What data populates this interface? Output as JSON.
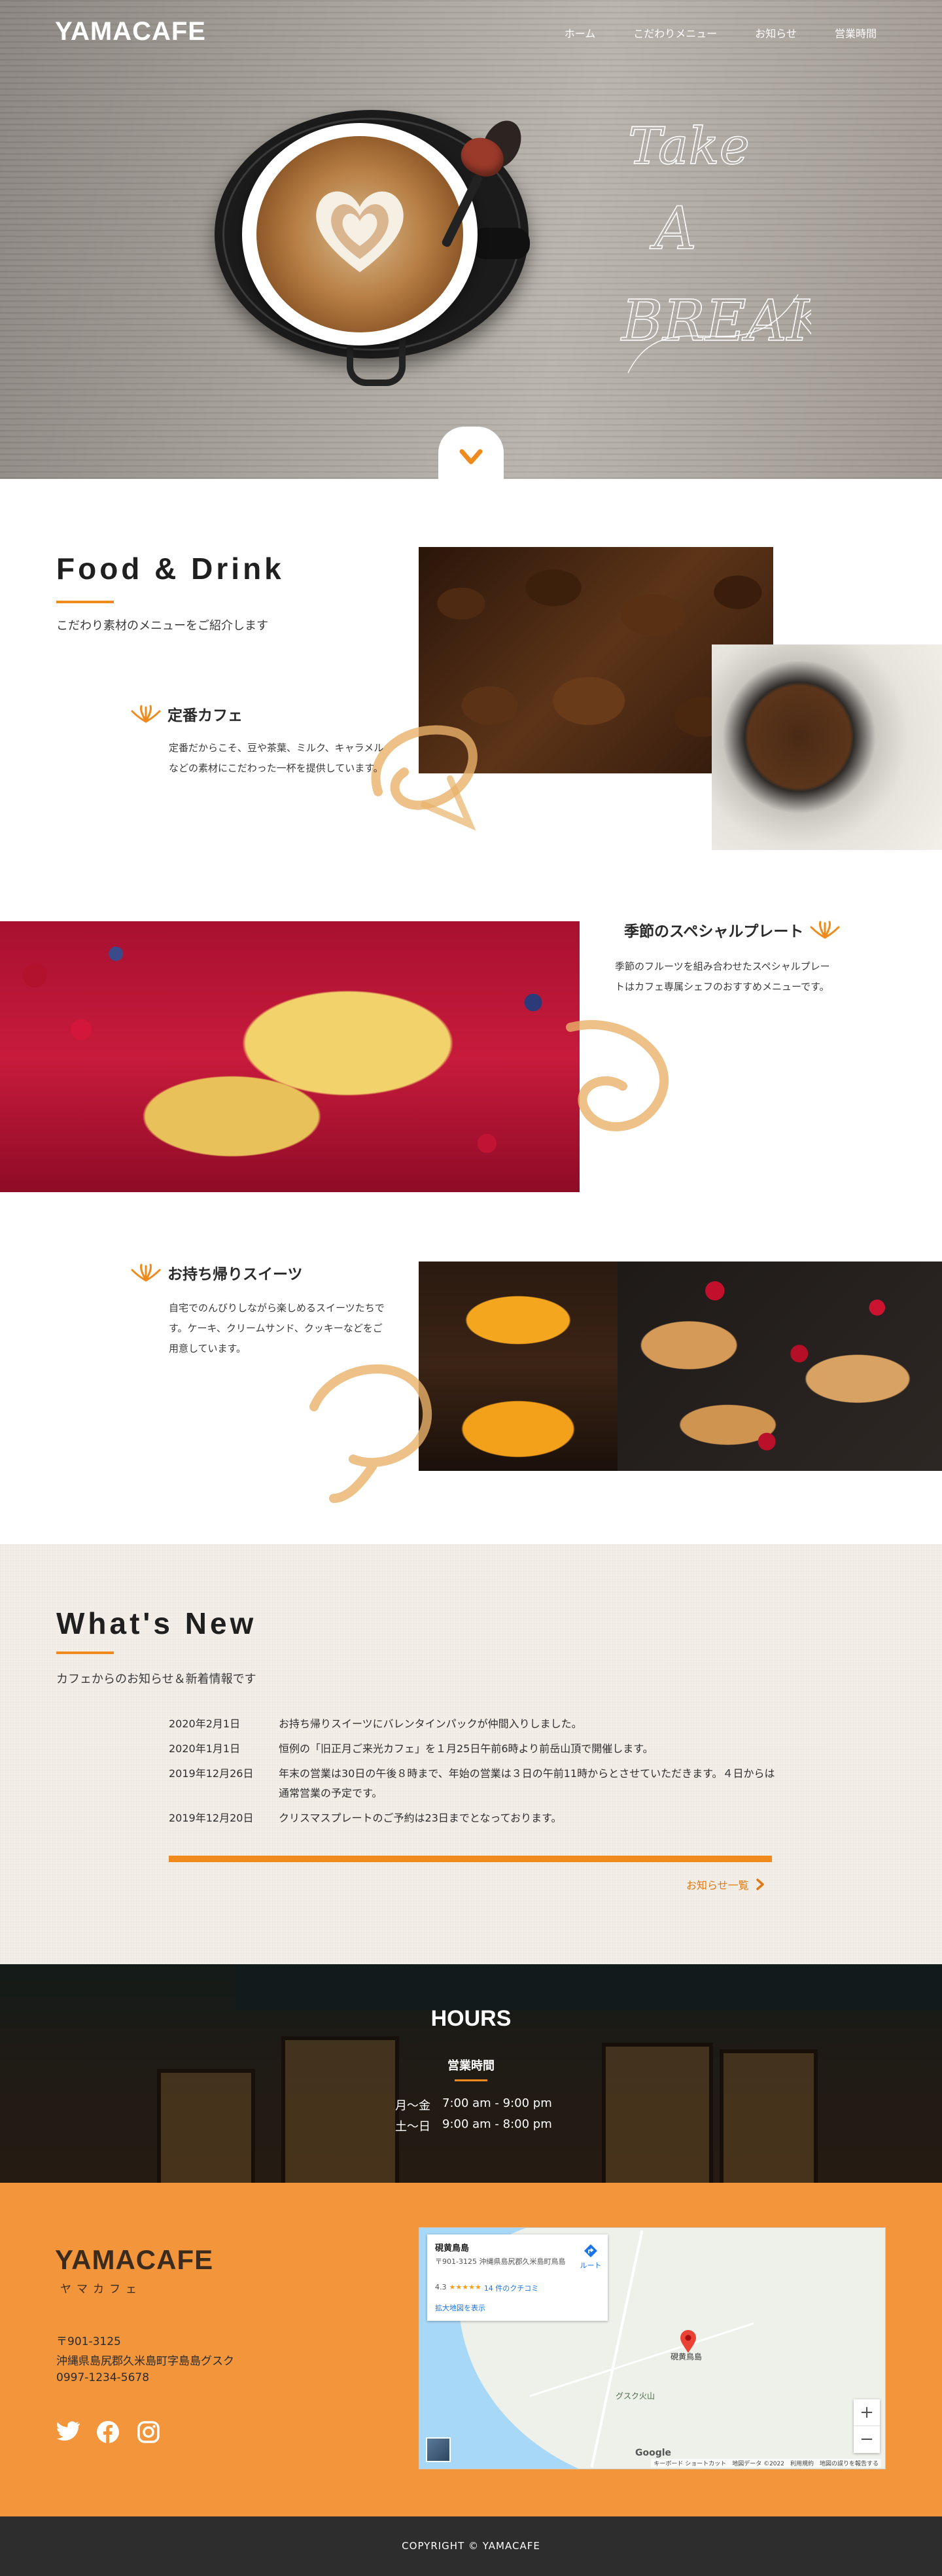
{
  "header": {
    "logo": "YAMACAFE",
    "nav": [
      "ホーム",
      "こだわりメニュー",
      "お知らせ",
      "営業時間"
    ]
  },
  "hero": {
    "script_text": "Take A BREAK"
  },
  "food_drink": {
    "title": "Food & Drink",
    "subtitle": "こだわり素材のメニューをご紹介します",
    "items": [
      {
        "title": "定番カフェ",
        "desc": "定番だからこそ、豆や茶葉、ミルク、キャラメルなどの素材にこだわった一杯を提供しています。"
      },
      {
        "title": "季節のスペシャルプレート",
        "desc": "季節のフルーツを組み合わせたスペシャルプレートはカフェ専属シェフのおすすめメニューです。"
      },
      {
        "title": "お持ち帰りスイーツ",
        "desc": "自宅でのんびりしながら楽しめるスイーツたちです。ケーキ、クリームサンド、クッキーなどをご用意しています。"
      }
    ]
  },
  "news": {
    "title": "What's New",
    "subtitle": "カフェからのお知らせ＆新着情報です",
    "entries": [
      {
        "date": "2020年2月1日",
        "text": "お持ち帰りスイーツにバレンタインパックが仲間入りしました。"
      },
      {
        "date": "2020年1月1日",
        "text": "恒例の「旧正月ご来光カフェ」を１月25日午前6時より前岳山頂で開催します。"
      },
      {
        "date": "2019年12月26日",
        "text": "年末の営業は30日の午後８時まで、年始の営業は３日の午前11時からとさせていただきます。４日からは通常営業の予定です。"
      },
      {
        "date": "2019年12月20日",
        "text": "クリスマスプレートのご予約は23日までとなっております。"
      }
    ],
    "more_label": "お知らせ一覧"
  },
  "hours": {
    "title": "HOURS",
    "subtitle": "営業時間",
    "rows": [
      {
        "days": "月〜金",
        "time": "7:00 am - 9:00 pm"
      },
      {
        "days": "土〜日",
        "time": "9:00 am - 8:00 pm"
      }
    ]
  },
  "footer": {
    "logo": "YAMACAFE",
    "logo_sub": "ヤマカフェ",
    "postal": "〒901-3125",
    "address": "沖縄県島尻郡久米島町字島島グスク",
    "phone": "0997-1234-5678",
    "social_icons": [
      "twitter-icon",
      "facebook-icon",
      "instagram-icon"
    ],
    "copyright": "COPYRIGHT © YAMACAFE"
  },
  "map": {
    "place_name": "硯黄鳥島",
    "place_address": "〒901-3125 沖縄県島尻郡久米島町鳥島",
    "rating": "4.3",
    "stars": "★★★★★",
    "reviews": "14 件のクチコミ",
    "enlarge_label": "拡大地図を表示",
    "route_label": "ルート",
    "pin_label": "硯黄鳥島",
    "peak_label": "グスク火山",
    "zoom_in": "+",
    "zoom_out": "−",
    "google_label": "Google",
    "attribution": "キーボード ショートカット　地図データ ©2022　利用規約　地図の誤りを報告する"
  },
  "colors": {
    "accent": "#f08a1c",
    "footer_bg": "#f3963b",
    "copyright_bg": "#2d2d2d"
  }
}
